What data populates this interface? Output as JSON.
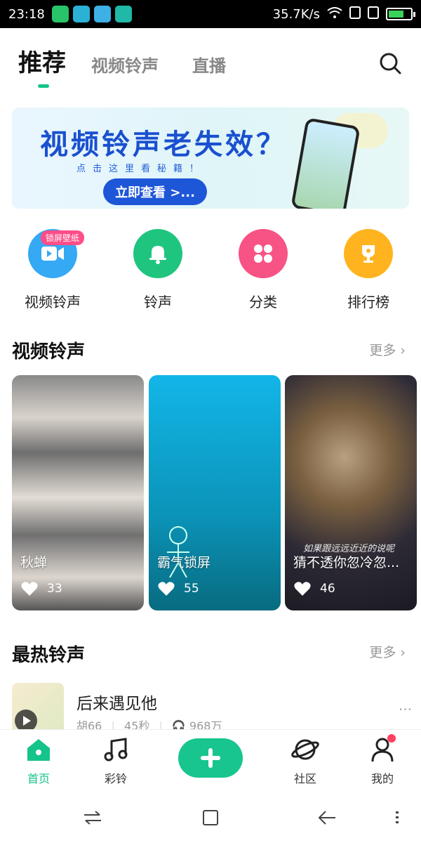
{
  "status": {
    "time": "23:18",
    "speed": "35.7K/s"
  },
  "colors": {
    "accent": "#15c48a",
    "banner_blue": "#1e56d8"
  },
  "topnav": {
    "tabs": [
      "推荐",
      "视频铃声",
      "直播"
    ],
    "active": 0
  },
  "banner": {
    "title": "视频铃声老失效？",
    "subtitle": "点击这里看秘籍！",
    "cta": "立即查看 >..."
  },
  "quick": [
    {
      "label": "视频铃声",
      "icon": "video-icon",
      "color": "#35a9f4",
      "badge": "锁屏壁纸"
    },
    {
      "label": "铃声",
      "icon": "bell-icon",
      "color": "#1fc57f"
    },
    {
      "label": "分类",
      "icon": "category-icon",
      "color": "#f75384"
    },
    {
      "label": "排行榜",
      "icon": "trophy-icon",
      "color": "#ffb41f"
    }
  ],
  "video_section": {
    "title": "视频铃声",
    "more": "更多 ›"
  },
  "videos": [
    {
      "name": "秋蝉",
      "likes": "33"
    },
    {
      "name": "霸气锁屏",
      "likes": "55"
    },
    {
      "name": "猜不透你忽冷忽...",
      "likes": "46",
      "overlay": "如果跟远远近近的说呢"
    }
  ],
  "hot_section": {
    "title": "最热铃声",
    "more": "更多 ›"
  },
  "songs": [
    {
      "title": "后来遇见他",
      "artist": "胡66",
      "duration": "45秒",
      "plays": "968万"
    }
  ],
  "tabbar": [
    {
      "label": "首页",
      "icon": "home-icon"
    },
    {
      "label": "彩铃",
      "icon": "music-note-icon"
    },
    {
      "label": "",
      "icon": "plus-icon"
    },
    {
      "label": "社区",
      "icon": "planet-icon"
    },
    {
      "label": "我的",
      "icon": "profile-icon"
    }
  ]
}
